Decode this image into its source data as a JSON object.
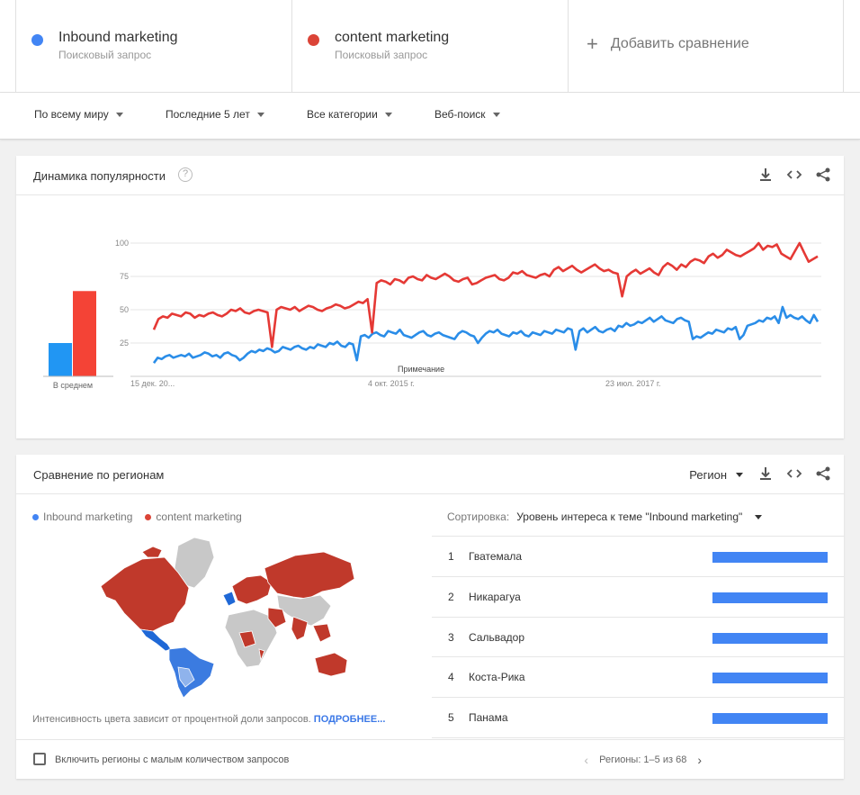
{
  "terms": [
    {
      "name": "Inbound marketing",
      "sub": "Поисковый запрос",
      "color": "#4285f4"
    },
    {
      "name": "content marketing",
      "sub": "Поисковый запрос",
      "color": "#db4437"
    }
  ],
  "add_compare": {
    "plus": "+",
    "label": "Добавить сравнение"
  },
  "filters": [
    "По всему миру",
    "Последние 5 лет",
    "Все категории",
    "Веб-поиск"
  ],
  "interest": {
    "title": "Динамика популярности",
    "help": "?",
    "avg_label": "В среднем",
    "note": "Примечание"
  },
  "chart_data": {
    "type": "line",
    "x": [
      "15 дек. 20...",
      "4 окт. 2015 г.",
      "23 июл. 2017 г."
    ],
    "yticks": [
      25,
      50,
      75,
      100
    ],
    "ylim": [
      0,
      100
    ],
    "grid": true,
    "legend": "none",
    "series": [
      {
        "name": "Inbound marketing",
        "color": "#4285f4",
        "average": 25,
        "values": [
          10,
          14,
          13,
          15,
          16,
          14,
          15,
          16,
          15,
          17,
          14,
          15,
          16,
          18,
          17,
          15,
          16,
          14,
          17,
          18,
          16,
          15,
          12,
          14,
          17,
          19,
          18,
          20,
          19,
          21,
          20,
          18,
          19,
          22,
          21,
          20,
          22,
          23,
          21,
          20,
          22,
          21,
          24,
          23,
          22,
          25,
          24,
          26,
          23,
          22,
          25,
          24,
          12,
          30,
          31,
          29,
          32,
          33,
          31,
          30,
          34,
          33,
          32,
          35,
          31,
          30,
          29,
          31,
          33,
          34,
          31,
          30,
          32,
          33,
          31,
          30,
          29,
          28,
          32,
          34,
          33,
          31,
          30,
          25,
          29,
          32,
          34,
          33,
          35,
          32,
          31,
          30,
          33,
          32,
          34,
          31,
          30,
          33,
          32,
          31,
          34,
          33,
          32,
          35,
          34,
          33,
          36,
          35,
          20,
          34,
          36,
          33,
          35,
          37,
          34,
          33,
          35,
          36,
          34,
          38,
          37,
          40,
          38,
          39,
          41,
          40,
          42,
          44,
          41,
          43,
          45,
          42,
          41,
          40,
          43,
          44,
          42,
          41
        ],
        "values2": [
          28,
          30,
          29,
          31,
          33,
          32,
          35,
          34,
          33,
          36,
          35,
          37,
          28,
          31,
          38,
          39,
          40,
          42,
          41,
          44,
          43,
          45,
          40,
          52,
          44,
          46,
          44,
          43,
          45,
          42,
          40,
          46,
          41
        ]
      },
      {
        "name": "content marketing",
        "color": "#db4437",
        "average": 64,
        "values": [
          35,
          43,
          45,
          44,
          47,
          46,
          45,
          48,
          47,
          44,
          46,
          45,
          47,
          48,
          46,
          45,
          47,
          50,
          49,
          51,
          48,
          47,
          49,
          50,
          49,
          48,
          22,
          50,
          52,
          51,
          50,
          52,
          49,
          51,
          53,
          52,
          50,
          49,
          51,
          52,
          54,
          53,
          51,
          52,
          54,
          56,
          55,
          58,
          33,
          70,
          72,
          71,
          69,
          73,
          72,
          70,
          74,
          75,
          73,
          72,
          76,
          74,
          73,
          75,
          77,
          75,
          72,
          71,
          73,
          74,
          69,
          70,
          72,
          74,
          75,
          76,
          73,
          72,
          74,
          78,
          77,
          79,
          76,
          75,
          74,
          76,
          77,
          75,
          80,
          82,
          79,
          81,
          83,
          80,
          78,
          80,
          82,
          84,
          81,
          79,
          80,
          78,
          77,
          60,
          75,
          78,
          80,
          77,
          79,
          81,
          78,
          76,
          82,
          85,
          83,
          80,
          84,
          82,
          86,
          88,
          87,
          85,
          90,
          92,
          89,
          91,
          95,
          93,
          91,
          90,
          92,
          94,
          96,
          100,
          95,
          98,
          97,
          99,
          92,
          90,
          88,
          94,
          100,
          93,
          86,
          88,
          90
        ]
      }
    ]
  },
  "regions": {
    "title": "Сравнение по регионам",
    "select_label": "Регион",
    "sort_label": "Сортировка:",
    "sort_value": "Уровень интереса к теме \"Inbound marketing\"",
    "map_note": "Интенсивность цвета зависит от процентной доли запросов.",
    "map_more": "ПОДРОБНЕЕ...",
    "rows": [
      {
        "rank": "1",
        "name": "Гватемала",
        "share": 1.0
      },
      {
        "rank": "2",
        "name": "Никарагуа",
        "share": 1.0
      },
      {
        "rank": "3",
        "name": "Сальвадор",
        "share": 1.0
      },
      {
        "rank": "4",
        "name": "Коста-Рика",
        "share": 1.0
      },
      {
        "rank": "5",
        "name": "Панама",
        "share": 1.0
      }
    ],
    "checkbox_label": "Включить регионы с малым количеством запросов",
    "pager_text": "Регионы: 1–5 из 68",
    "pager_prev": "‹",
    "pager_next": "›"
  }
}
